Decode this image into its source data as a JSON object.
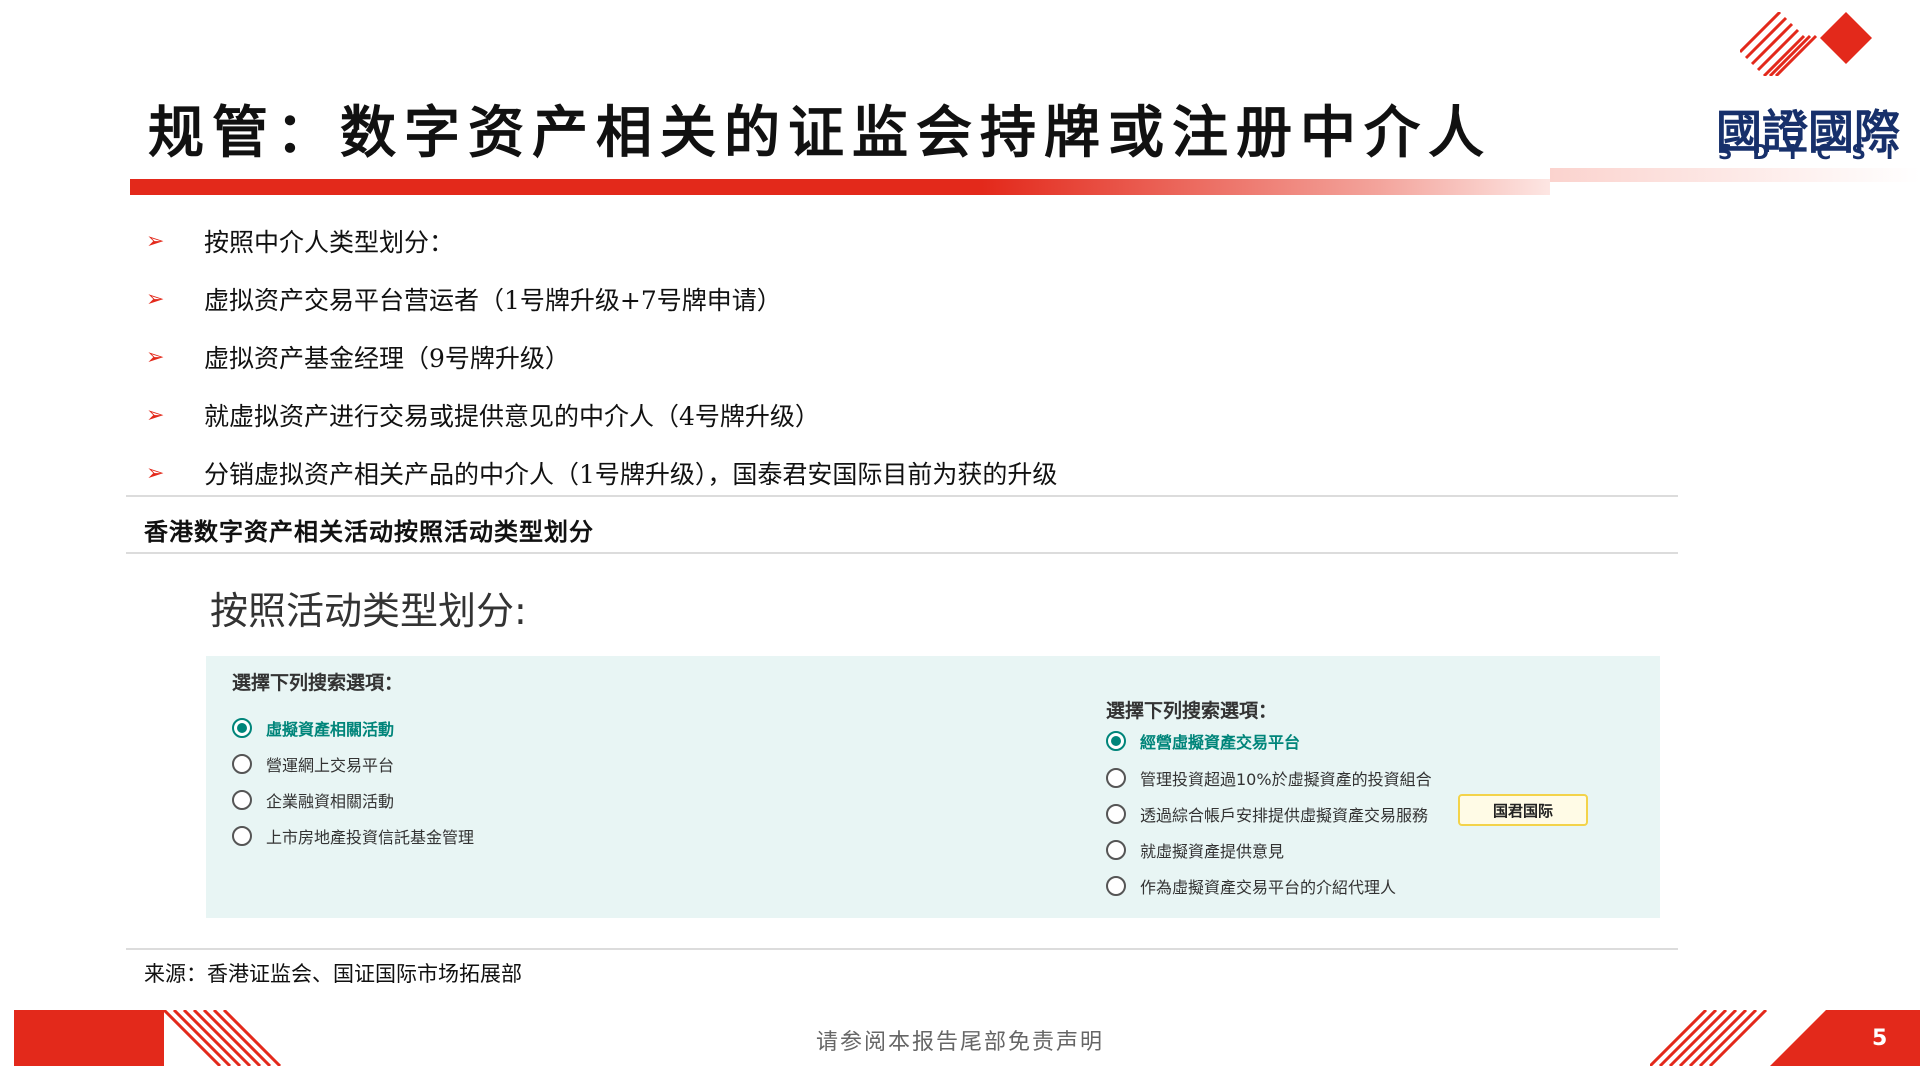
{
  "title": "规管：数字资产相关的证监会持牌或注册中介人",
  "logo": {
    "cn": "國證國際",
    "en": "SDICSI",
    "brand_color": "#17306b",
    "accent_color": "#e3291b"
  },
  "bullets": [
    "按照中介人类型划分：",
    "虚拟资产交易平台营运者（1号牌升级+7号牌申请）",
    "虚拟资产基金经理（9号牌升级）",
    "就虚拟资产进行交易或提供意见的中介人（4号牌升级）",
    "分销虚拟资产相关产品的中介人（1号牌升级），国泰君安国际目前为获的升级"
  ],
  "section_title": "香港数字资产相关活动按照活动类型划分",
  "sub_heading": "按照活动类型划分:",
  "panel": {
    "left_heading": "選擇下列搜索選項：",
    "left_options": [
      {
        "label": "虛擬資產相關活動",
        "selected": true
      },
      {
        "label": "營運網上交易平台",
        "selected": false
      },
      {
        "label": "企業融資相關活動",
        "selected": false
      },
      {
        "label": "上市房地產投資信託基金管理",
        "selected": false
      }
    ],
    "right_heading": "選擇下列搜索選項：",
    "right_options": [
      {
        "label": "經營虛擬資產交易平台",
        "selected": true
      },
      {
        "label": "管理投資超過10%於虛擬資產的投資組合",
        "selected": false
      },
      {
        "label": "透過綜合帳戶安排提供虛擬資產交易服務",
        "selected": false
      },
      {
        "label": "就虛擬資產提供意見",
        "selected": false
      },
      {
        "label": "作為虛擬資產交易平台的介紹代理人",
        "selected": false
      }
    ],
    "tag": "国君国际",
    "background_color": "#e8f5f4",
    "selected_color": "#00857a"
  },
  "source": "来源：香港证监会、国证国际市场拓展部",
  "footer": {
    "disclaimer": "请参阅本报告尾部免责声明",
    "page_number": "5"
  }
}
